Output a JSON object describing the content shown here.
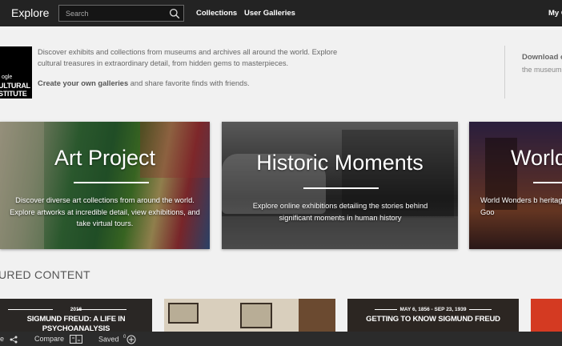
{
  "header": {
    "brand": "Explore",
    "search_placeholder": "Search",
    "nav": [
      "Collections",
      "User Galleries"
    ],
    "right_link": "My C"
  },
  "intro": {
    "logo_lines": [
      "ogle",
      "ULTURAL",
      "STITUTE"
    ],
    "text": "Discover exhibits and collections from museums and archives all around the world. Explore cultural treasures in extraordinary detail, from hidden gems to masterpieces.",
    "galleries_bold": "Create your own galleries",
    "galleries_rest": " and share favorite finds with friends.",
    "download_title": "Download o",
    "download_sub": "the museum"
  },
  "cards": [
    {
      "title": "Art Project",
      "description": "Discover diverse art collections from around the world. Explore artworks at incredible detail, view exhibitions, and take virtual tours."
    },
    {
      "title": "Historic Moments",
      "description": "Explore online exhibitions detailing the stories behind significant moments in human history"
    },
    {
      "title": "World",
      "description": "World Wonders b heritage sites onl Goo"
    }
  ],
  "featured": {
    "heading": "URED CONTENT",
    "tiles": [
      {
        "date": "2016",
        "title": "SIGMUND FREUD: A LIFE IN PSYCHOANALYSIS"
      },
      {
        "date": "",
        "title": ""
      },
      {
        "date": "MAY 6, 1856 - SEP 23, 1939",
        "title": "GETTING TO KNOW SIGMUND FREUD"
      },
      {
        "date": "",
        "title": ""
      }
    ]
  },
  "bottombar": {
    "share": "e",
    "compare": "Compare",
    "saved": "Saved",
    "saved_count": "0"
  },
  "colors": {
    "topbar": "#232323",
    "page_bg": "#f1f1f1",
    "bottombar": "#2b2b2b"
  }
}
